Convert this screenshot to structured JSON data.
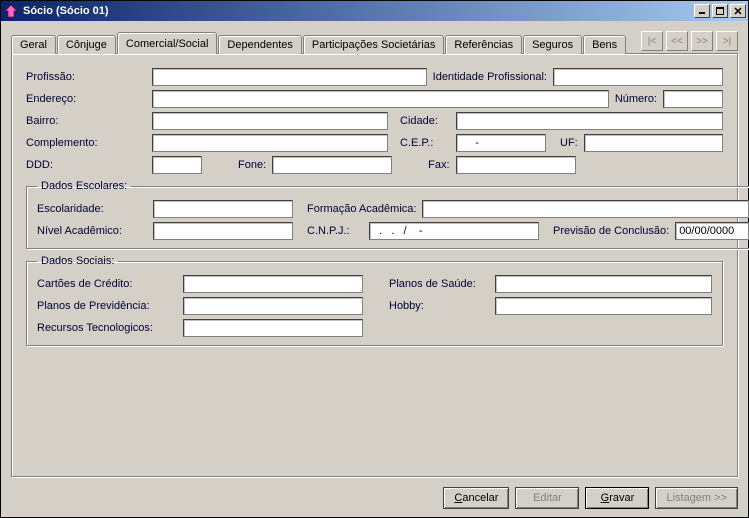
{
  "window": {
    "title": "Sócio (Sócio 01)"
  },
  "tabs": {
    "geral": "Geral",
    "conjuge": "Cônjuge",
    "comercial": "Comercial/Social",
    "dependentes": "Dependentes",
    "participacoes": "Participações Societárias",
    "referencias": "Referências",
    "seguros": "Seguros",
    "bens": "Bens"
  },
  "nav": {
    "first": "|<",
    "prev": "<<",
    "next": ">>",
    "last": ">|"
  },
  "labels": {
    "profissao": "Profissão:",
    "identidade_prof": "Identidade Profissional:",
    "endereco": "Endereço:",
    "numero": "Número:",
    "bairro": "Bairro:",
    "cidade": "Cidade:",
    "complemento": "Complemento:",
    "cep": "C.E.P.:",
    "uf": "UF:",
    "ddd": "DDD:",
    "fone": "Fone:",
    "fax": "Fax:",
    "dados_escolares": "Dados Escolares:",
    "escolaridade": "Escolaridade:",
    "formacao": "Formação Acadêmica:",
    "nivel_academico": "Nível Acadêmico:",
    "cnpj": "C.N.P.J.:",
    "previsao": "Previsão de Conclusão:",
    "dados_sociais": "Dados Sociais:",
    "cartoes": "Cartões de Crédito:",
    "planos_saude": "Planos de Saúde:",
    "planos_prev": "Planos de Previdência:",
    "hobby": "Hobby:",
    "recursos": "Recursos Tecnologicos:"
  },
  "values": {
    "profissao": "",
    "identidade_prof": "",
    "endereco": "",
    "numero": "",
    "bairro": "",
    "cidade": "",
    "complemento": "",
    "cep": "     -",
    "uf": "",
    "ddd": "",
    "fone": "",
    "fax": "",
    "escolaridade": "",
    "formacao": "",
    "nivel_academico": "",
    "cnpj": "  .   .   /    -",
    "previsao": "00/00/0000",
    "cartoes": "",
    "planos_saude": "",
    "planos_prev": "",
    "hobby": "",
    "recursos": ""
  },
  "buttons": {
    "cancelar": "Cancelar",
    "editar": "Editar",
    "gravar": "Gravar",
    "listagem": "Listagem >>"
  }
}
